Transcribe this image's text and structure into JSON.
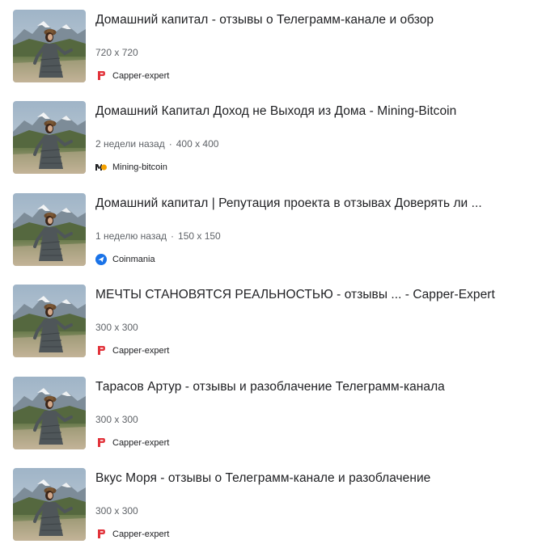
{
  "colors": {
    "title": "#202124",
    "meta": "#5f6368",
    "capper_red": "#e2333b",
    "coinmania_blue": "#1a73e8",
    "mining_orange": "#f4a100"
  },
  "results": [
    {
      "title": "Домашний капитал - отзывы о Телеграмм-канале и обзор",
      "age": "",
      "size": "720 x 720",
      "source": "Capper-expert",
      "favicon": "capper-expert-icon"
    },
    {
      "title": "Домашний Капитал Доход не Выходя из Дома - Mining-Bitcoin",
      "age": "2 недели назад",
      "size": "400 x 400",
      "source": "Mining-bitcoin",
      "favicon": "mining-bitcoin-icon"
    },
    {
      "title": "Домашний капитал | Репутация проекта в отзывах Доверять ли ...",
      "age": "1 неделю назад",
      "size": "150 x 150",
      "source": "Coinmania",
      "favicon": "coinmania-icon"
    },
    {
      "title": "МЕЧТЫ СТАНОВЯТСЯ РЕАЛЬНОСТЬЮ - отзывы ... - Capper-Expert",
      "age": "",
      "size": "300 x 300",
      "source": "Capper-expert",
      "favicon": "capper-expert-icon"
    },
    {
      "title": "Тарасов Артур - отзывы и разоблачение Телеграмм-канала",
      "age": "",
      "size": "300 x 300",
      "source": "Capper-expert",
      "favicon": "capper-expert-icon"
    },
    {
      "title": "Вкус Моря - отзывы о Телеграмм-канале и разоблачение",
      "age": "",
      "size": "300 x 300",
      "source": "Capper-expert",
      "favicon": "capper-expert-icon"
    }
  ]
}
